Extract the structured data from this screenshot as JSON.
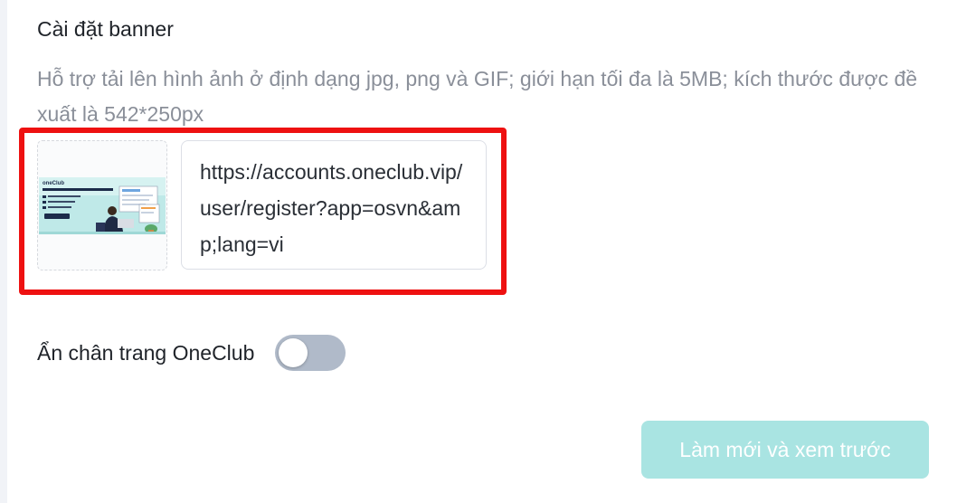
{
  "section_title": "Cài đặt banner",
  "hint": "Hỗ trợ tải lên hình ảnh ở định dạng jpg, png và GIF; giới hạn tối đa là 5MB; kích thước được đề xuất là 542*250px",
  "banner": {
    "thumbnail_brand": "oneClub",
    "url_value": "https://accounts.oneclub.vip/user/register?app=osvn&amp;lang=vi"
  },
  "footer_toggle": {
    "label": "Ẩn chân trang OneClub",
    "enabled": false
  },
  "refresh_button_label": "Làm mới và xem trước",
  "colors": {
    "highlight": "#ee1111",
    "toggle_off": "#b0bac9",
    "button_disabled": "#a9e4e2"
  }
}
